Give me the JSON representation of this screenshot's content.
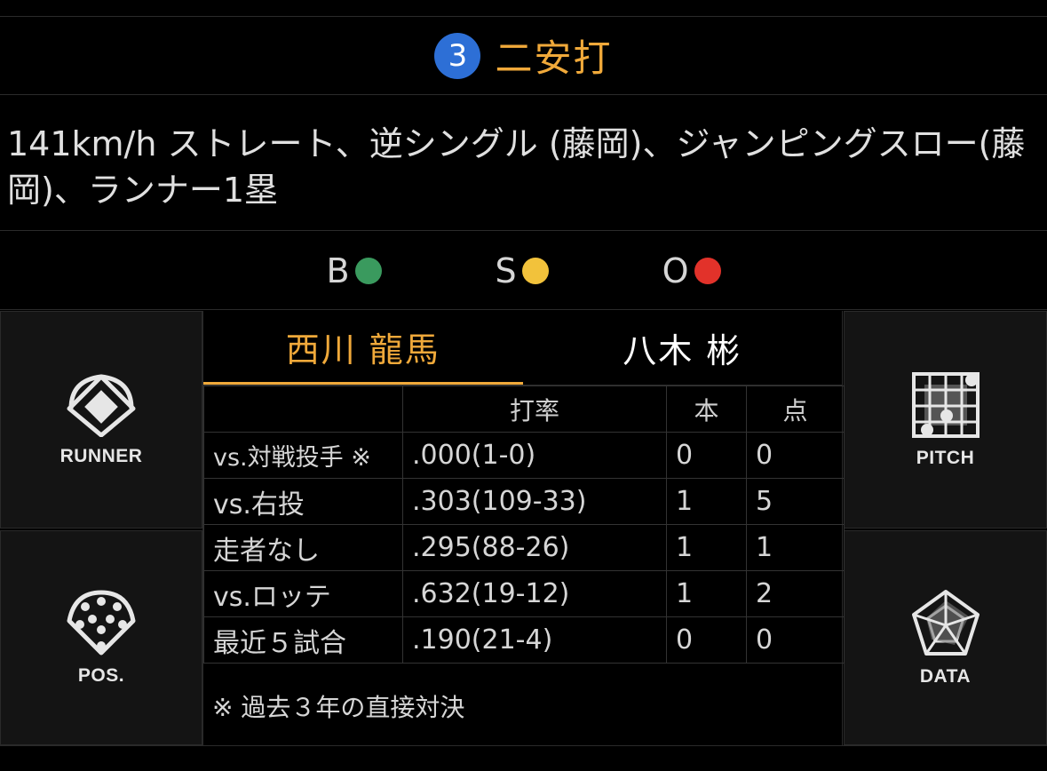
{
  "play": {
    "number": "3",
    "result": "二安打",
    "description": "141km/h ストレート、逆シングル (藤岡)、ジャンピングスロー(藤岡)、ランナー1塁"
  },
  "count": {
    "balls_label": "B",
    "strikes_label": "S",
    "outs_label": "O",
    "balls": 1,
    "strikes": 1,
    "outs": 1,
    "colors": {
      "ball": "#3a9a5e",
      "strike": "#f2c23b",
      "out": "#e2322a"
    }
  },
  "nav": {
    "runner": "RUNNER",
    "pitch": "PITCH",
    "pos": "POS.",
    "data": "DATA"
  },
  "players": {
    "batter": "西川 龍馬",
    "pitcher": "八木 彬"
  },
  "stats": {
    "headers": [
      "",
      "打率",
      "本",
      "点"
    ],
    "rows": [
      {
        "label": "vs.対戦投手 ※",
        "avg": ".000(1-0)",
        "hr": "0",
        "rbi": "0"
      },
      {
        "label": "vs.右投",
        "avg": ".303(109-33)",
        "hr": "1",
        "rbi": "5"
      },
      {
        "label": "走者なし",
        "avg": ".295(88-26)",
        "hr": "1",
        "rbi": "1"
      },
      {
        "label": "vs.ロッテ",
        "avg": ".632(19-12)",
        "hr": "1",
        "rbi": "2"
      },
      {
        "label": "最近５試合",
        "avg": ".190(21-4)",
        "hr": "0",
        "rbi": "0"
      }
    ],
    "note": "※ 過去３年の直接対決"
  },
  "colors": {
    "accent": "#f0a93a",
    "badge": "#2d6fd6"
  }
}
